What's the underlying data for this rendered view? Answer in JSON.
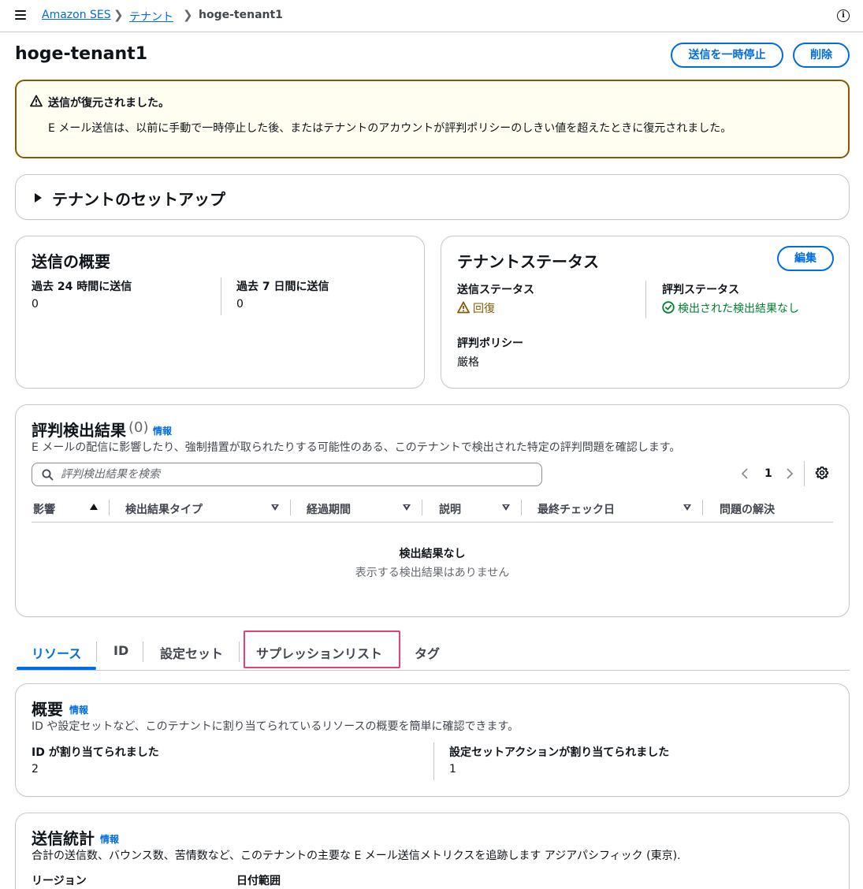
{
  "breadcrumb": {
    "items": [
      "Amazon SES",
      "テナント"
    ],
    "current": "hoge-tenant1"
  },
  "page": {
    "title": "hoge-tenant1",
    "pause_button": "送信を一時停止",
    "delete_button": "削除"
  },
  "alert": {
    "title": "送信が復元されました。",
    "body": "E メール送信は、以前に手動で一時停止した後、またはテナントのアカウントが評判ポリシーのしきい値を超えたときに復元されました。"
  },
  "setup": {
    "title": "テナントのセットアップ"
  },
  "sending_summary": {
    "title": "送信の概要",
    "items": [
      {
        "label": "過去 24 時間に送信",
        "value": "0"
      },
      {
        "label": "過去 7 日間に送信",
        "value": "0"
      }
    ]
  },
  "tenant_status": {
    "title": "テナントステータス",
    "edit_button": "編集",
    "sending_status_label": "送信ステータス",
    "sending_status_value": "回復",
    "reputation_status_label": "評判ステータス",
    "reputation_status_value": "検出された検出結果なし",
    "policy_label": "評判ポリシー",
    "policy_value": "厳格"
  },
  "findings": {
    "title": "評判検出結果",
    "count": "(0)",
    "info": "情報",
    "description": "E メールの配信に影響したり、強制措置が取られたりする可能性のある、このテナントで検出された特定の評判問題を確認します。",
    "search_placeholder": "評判検出結果を検索",
    "page_number": "1",
    "columns": [
      "影響",
      "検出結果タイプ",
      "経過期間",
      "説明",
      "最終チェック日",
      "問題の解決"
    ],
    "empty_title": "検出結果なし",
    "empty_text": "表示する検出結果はありません"
  },
  "tabs": [
    "リソース",
    "ID",
    "設定セット",
    "サプレッションリスト",
    "タグ"
  ],
  "overview": {
    "title": "概要",
    "info": "情報",
    "description": "ID や設定セットなど、このテナントに割り当てられているリソースの概要を簡単に確認できます。",
    "items": [
      {
        "label": "ID が割り当てられました",
        "value": "2"
      },
      {
        "label": "設定セットアクションが割り当てられました",
        "value": "1"
      }
    ]
  },
  "stats": {
    "title": "送信統計",
    "info": "情報",
    "description": "合計の送信数、バウンス数、苦情数など、このテナントの主要な E メール送信メトリクスを追跡します アジアパシフィック (東京).",
    "region_label": "リージョン",
    "date_range_label": "日付範囲"
  },
  "colors": {
    "link": "#006ce0",
    "warning": "#855900",
    "success": "#00802f",
    "highlight": "#e5407a"
  }
}
